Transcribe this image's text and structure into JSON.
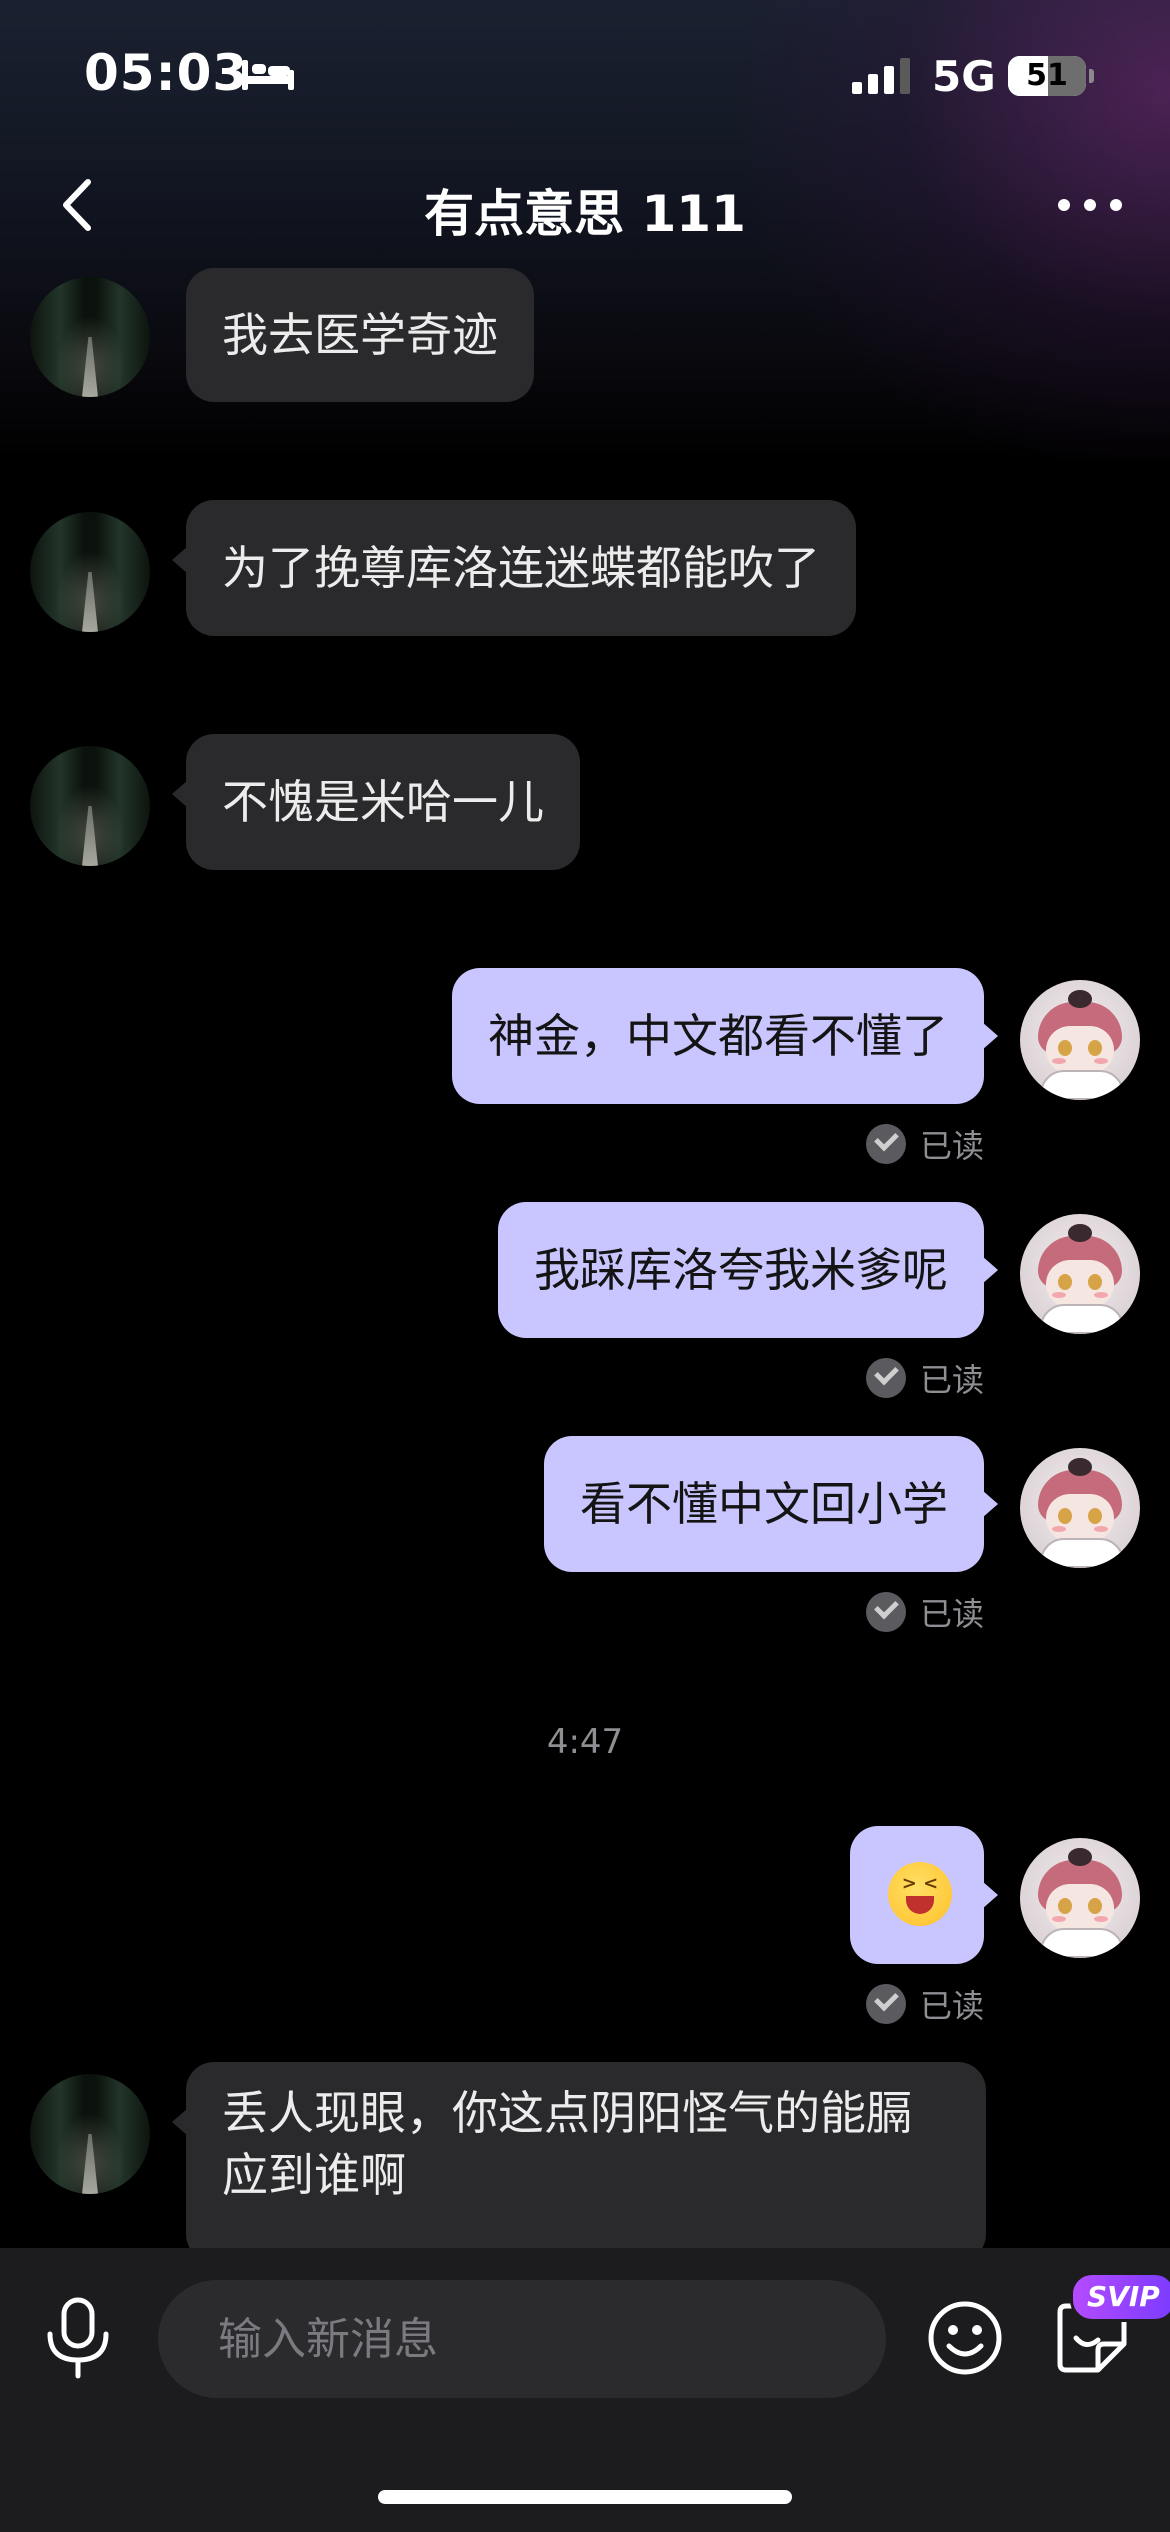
{
  "status_bar": {
    "time": "05:03",
    "network": "5G",
    "battery_percent": 51,
    "battery_text": "51"
  },
  "header": {
    "title": "有点意思 111",
    "back_icon": "chevron-left-icon",
    "more_icon": "ellipsis-icon"
  },
  "messages": [
    {
      "side": "in",
      "text": "我去医学奇迹"
    },
    {
      "side": "in",
      "text": "为了挽尊库洛连迷蝶都能吹了"
    },
    {
      "side": "in",
      "text": "不愧是米哈一儿"
    },
    {
      "side": "out",
      "text": "神金，中文都看不懂了",
      "status": "已读"
    },
    {
      "side": "out",
      "text": "我踩库洛夸我米爹呢",
      "status": "已读"
    },
    {
      "side": "out",
      "text": "看不懂中文回小学",
      "status": "已读"
    },
    {
      "type": "timestamp",
      "text": "4:47"
    },
    {
      "side": "out",
      "emoji": "laughing-face-emoji",
      "status": "已读"
    },
    {
      "side": "in",
      "text": "丢人现眼，你这点阴阳怪气的能膈应到谁啊"
    }
  ],
  "input_bar": {
    "placeholder": "输入新消息",
    "svip_badge": "SVIP",
    "mic_icon": "microphone-icon",
    "emoji_icon": "smiley-icon",
    "sticker_icon": "sticker-icon"
  },
  "colors": {
    "background": "#000000",
    "incoming_bubble": "#2a2a2d",
    "outgoing_bubble": "#c9c6ff",
    "input_bar": "#1c1c1e",
    "svip": "#9b45ff"
  }
}
